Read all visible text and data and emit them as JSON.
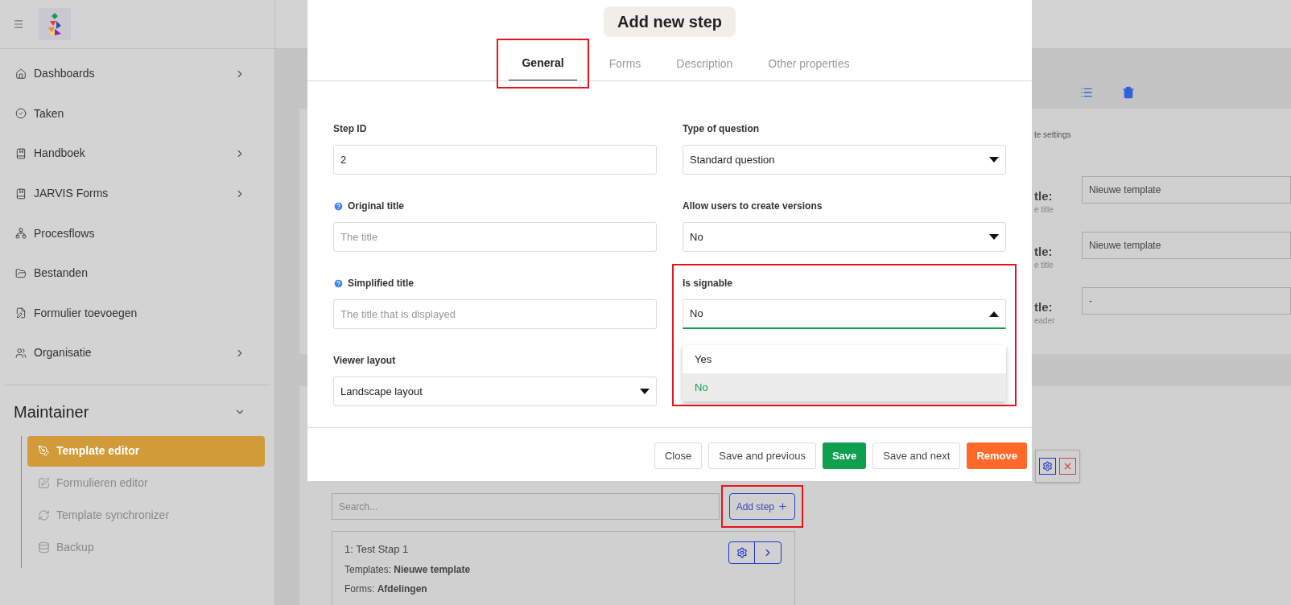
{
  "sidebar": {
    "items": [
      {
        "label": "Dashboards",
        "has_children": true
      },
      {
        "label": "Taken",
        "has_children": false
      },
      {
        "label": "Handboek",
        "has_children": true
      },
      {
        "label": "JARVIS Forms",
        "has_children": true
      },
      {
        "label": "Procesflows",
        "has_children": false
      },
      {
        "label": "Bestanden",
        "has_children": false
      },
      {
        "label": "Formulier toevoegen",
        "has_children": false
      },
      {
        "label": "Organisatie",
        "has_children": true
      }
    ],
    "section": {
      "title": "Maintainer",
      "expanded": true,
      "items": [
        {
          "label": "Template editor",
          "selected": true
        },
        {
          "label": "Formulieren editor",
          "selected": false
        },
        {
          "label": "Template synchronizer",
          "selected": false
        },
        {
          "label": "Backup",
          "selected": false
        }
      ]
    }
  },
  "background": {
    "settings_text": "te settings",
    "rows": [
      {
        "label": "tle:",
        "hint": "e title",
        "value": "Nieuwe template"
      },
      {
        "label": "tle:",
        "hint": "e title",
        "value": "Nieuwe template"
      },
      {
        "label": "tle:",
        "hint": "eader",
        "value": "-"
      }
    ],
    "search": {
      "placeholder": "Search..."
    },
    "add_button": {
      "label": "Add step",
      "annotated": true
    },
    "steps": [
      {
        "title": "1: Test Stap 1",
        "templates": "Templates: **Nieuwe template**",
        "forms": "Forms: **Afdelingen**"
      }
    ]
  },
  "dialog": {
    "title": "Add new step",
    "tabs": [
      {
        "label": "General",
        "selected": true,
        "annotated": true
      },
      {
        "label": "Forms",
        "selected": false,
        "annotated": false
      },
      {
        "label": "Description",
        "selected": false,
        "annotated": false
      },
      {
        "label": "Other properties",
        "selected": false,
        "annotated": false
      }
    ],
    "fields": [
      {
        "kind": "text",
        "label": "Step ID",
        "help": false,
        "value": "2"
      },
      {
        "kind": "text",
        "label": "Original title",
        "help": true,
        "placeholder": "The title"
      },
      {
        "kind": "text",
        "label": "Simplified title",
        "help": true,
        "placeholder": "The title that is displayed"
      },
      {
        "kind": "select",
        "label": "Viewer layout",
        "value": "Landscape layout",
        "open": false
      },
      {
        "kind": "select",
        "label": "Type of question",
        "value": "Standard question",
        "open": false
      },
      {
        "kind": "select",
        "label": "Allow users to create versions",
        "value": "No",
        "open": false
      },
      {
        "kind": "select",
        "label": "Is signable",
        "value": "No",
        "open": true,
        "annotated": true,
        "options": [
          {
            "label": "Yes",
            "selected": false
          },
          {
            "label": "No",
            "selected": true
          }
        ]
      }
    ],
    "buttons": [
      {
        "label": "Close",
        "kind": "outline"
      },
      {
        "label": "Save and previous",
        "kind": "outline"
      },
      {
        "label": "Save",
        "kind": "primary"
      },
      {
        "label": "Save and next",
        "kind": "outline"
      },
      {
        "label": "Remove",
        "kind": "danger"
      }
    ]
  }
}
